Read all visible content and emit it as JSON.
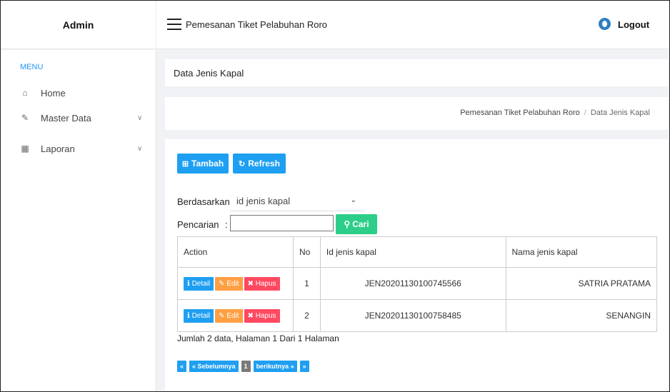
{
  "header": {
    "brand": "Admin",
    "app_title": "Pemesanan Tiket Pelabuhan Roro",
    "logout_label": "Logout"
  },
  "sidebar": {
    "menu_label": "MENU",
    "items": [
      {
        "label": "Home",
        "icon": "home-icon",
        "glyph": "🏠"
      },
      {
        "label": "Master Data",
        "icon": "edit-icon",
        "glyph": "✎",
        "chevron": "∨"
      },
      {
        "label": "Laporan",
        "icon": "calendar-icon",
        "glyph": "▦",
        "chevron": "∨"
      }
    ]
  },
  "page": {
    "title": "Data Jenis Kapal",
    "breadcrumb": {
      "root": "Pemesanan Tiket Pelabuhan Roro",
      "separator": "/",
      "current": "Data Jenis Kapal"
    }
  },
  "toolbar": {
    "add_label": "Tambah",
    "refresh_label": "Refresh"
  },
  "filter": {
    "by_label": "Berdasarkan:",
    "by_selected": "id jenis kapal",
    "search_label": "Pencarian",
    "search_colon": ":",
    "search_value": "",
    "search_button": "Cari"
  },
  "table": {
    "headers": [
      "Action",
      "No",
      "Id jenis kapal",
      "Nama jenis kapal"
    ],
    "action_labels": {
      "detail": "Detail",
      "edit": "Edit",
      "hapus": "Hapus"
    },
    "rows": [
      {
        "no": "1",
        "id": "JEN20201130100745566",
        "nama": "SATRIA PRATAMA"
      },
      {
        "no": "2",
        "id": "JEN20201130100758485",
        "nama": "SENANGIN"
      }
    ]
  },
  "summary": "Jumlah 2 data, Halaman 1 Dari 1 Halaman",
  "pagination": {
    "first": "«",
    "prev": "« Sebelumnya",
    "current": "1",
    "next": "berikutnya »",
    "last": "»"
  },
  "colors": {
    "primary": "#1e9ff2",
    "success": "#2dce89",
    "warning": "#ff9f43",
    "danger": "#ff4961"
  }
}
